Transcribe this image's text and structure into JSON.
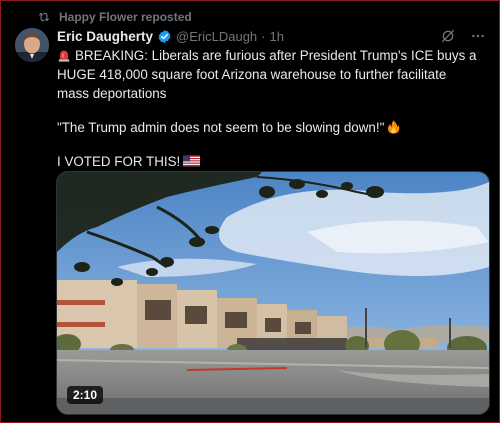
{
  "repost": {
    "label": "Happy Flower reposted",
    "icon": "repost-icon"
  },
  "tweet": {
    "author_name": "Eric Daugherty",
    "handle": "@EricLDaugh",
    "separator": "·",
    "time": "1h",
    "verified": true,
    "colors": {
      "verified": "#1d9bf0",
      "muted_text": "#71767b",
      "text": "#e7e9ea",
      "background": "#000000"
    },
    "text_line1": "BREAKING: Liberals are furious after President Trump's ICE buys a HUGE 418,000 square foot Arizona warehouse to further facilitate mass deportations",
    "text_line2": "\"The Trump admin does not seem to be slowing down!\"",
    "text_line3": "I VOTED FOR THIS!",
    "emoji": {
      "siren": "siren-icon",
      "fire": "fire-icon",
      "flag": "us-flag-icon"
    },
    "media": {
      "type": "video",
      "duration": "2:10"
    }
  },
  "header_icons": [
    "grok-icon",
    "more-icon"
  ]
}
